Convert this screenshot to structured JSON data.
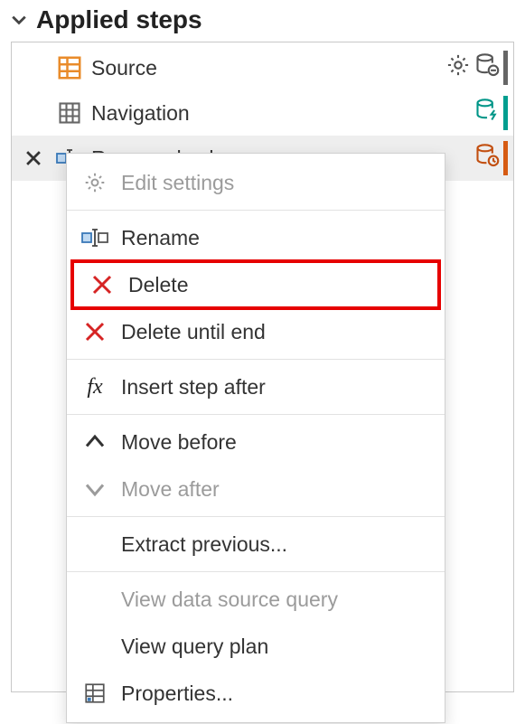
{
  "section": {
    "title": "Applied steps"
  },
  "steps": [
    {
      "label": "Source",
      "icon": "table-orange",
      "gear": true,
      "db": "db-minus",
      "accent": "#666666"
    },
    {
      "label": "Navigation",
      "icon": "grid",
      "gear": false,
      "db": "db-bolt",
      "accent": "#009e8f"
    },
    {
      "label": "Renamed columns",
      "icon": "rename-col",
      "gear": false,
      "db": "db-clock",
      "accent": "#d65b12",
      "selected": true
    }
  ],
  "menu": {
    "edit_settings": "Edit settings",
    "rename": "Rename",
    "delete": "Delete",
    "delete_until_end": "Delete until end",
    "insert_step_after": "Insert step after",
    "move_before": "Move before",
    "move_after": "Move after",
    "extract_previous": "Extract previous...",
    "view_data_source_query": "View data source query",
    "view_query_plan": "View query plan",
    "properties": "Properties..."
  }
}
